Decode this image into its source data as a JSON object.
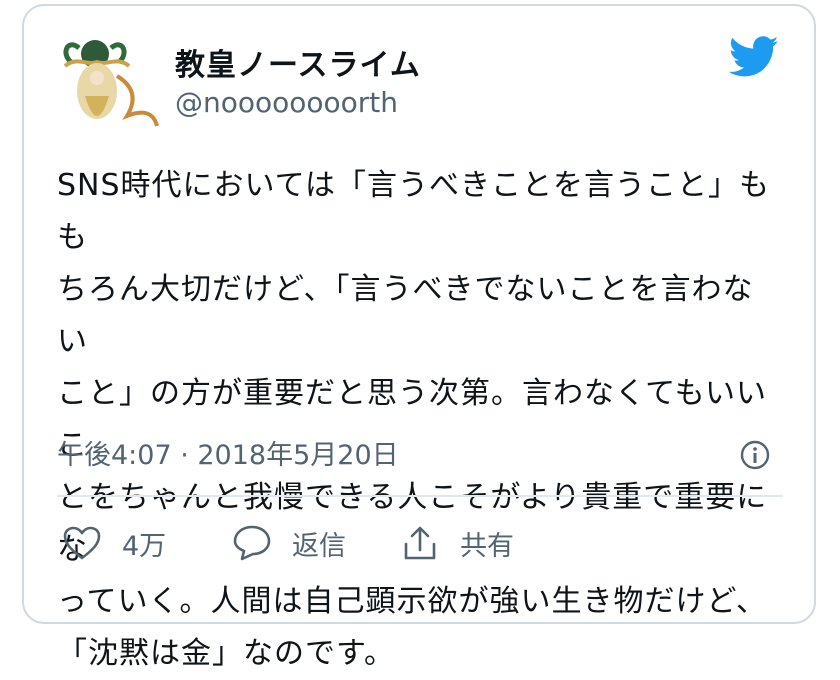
{
  "author": {
    "display_name": "教皇ノースライム",
    "handle": "@noooooooorth"
  },
  "tweet": {
    "text": "SNS時代においては「言うべきことを言うこと」もも\nちろん大切だけど、「言うべきでないことを言わない\nこと」の方が重要だと思う次第。言わなくてもいいこ\nとをちゃんと我慢できる人こそがより貴重で重要にな\nっていく。人間は自己顕示欲が強い生き物だけど、\n「沈黙は金」なのです。",
    "timestamp": "午後4:07 · 2018年5月20日"
  },
  "actions": {
    "like_count": "4万",
    "reply_label": "返信",
    "share_label": "共有"
  },
  "colors": {
    "brand": "#1d9bf0",
    "secondary_text": "#536471",
    "border": "#cfd9de"
  },
  "icons": [
    "twitter-bird-icon",
    "info-icon",
    "heart-icon",
    "reply-bubble-icon",
    "share-icon"
  ]
}
